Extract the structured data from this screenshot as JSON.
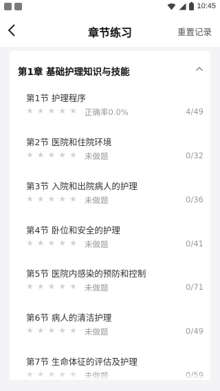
{
  "status_bar": {
    "time": "10:45"
  },
  "header": {
    "title": "章节练习",
    "reset_label": "重置记录"
  },
  "chapter": {
    "title": "第1章 基础护理知识与技能"
  },
  "sections": [
    {
      "title": "第1节  护理程序",
      "status": "正确率0.0%",
      "count": "4/49",
      "rating": 0
    },
    {
      "title": "第2节  医院和住院环境",
      "status": "未做题",
      "count": "0/32",
      "rating": 0
    },
    {
      "title": "第3节  入院和出院病人的护理",
      "status": "未做题",
      "count": "0/36",
      "rating": 0
    },
    {
      "title": "第4节  卧位和安全的护理",
      "status": "未做题",
      "count": "0/41",
      "rating": 0
    },
    {
      "title": "第5节  医院内感染的预防和控制",
      "status": "未做题",
      "count": "0/71",
      "rating": 0
    },
    {
      "title": "第6节  病人的清洁护理",
      "status": "未做题",
      "count": "0/49",
      "rating": 0
    },
    {
      "title": "第7节  生命体征的评估及护理",
      "status": "未做题",
      "count": "0/59",
      "rating": 0
    }
  ],
  "colors": {
    "star_empty": "#d2d2d2",
    "muted_text": "#999999",
    "card_bg": "#ffffff",
    "page_bg": "#f4f4f6"
  },
  "icons": [
    "back-arrow-icon",
    "chevron-up-icon",
    "star-icon",
    "wifi-icon",
    "signal-icon",
    "battery-icon"
  ]
}
